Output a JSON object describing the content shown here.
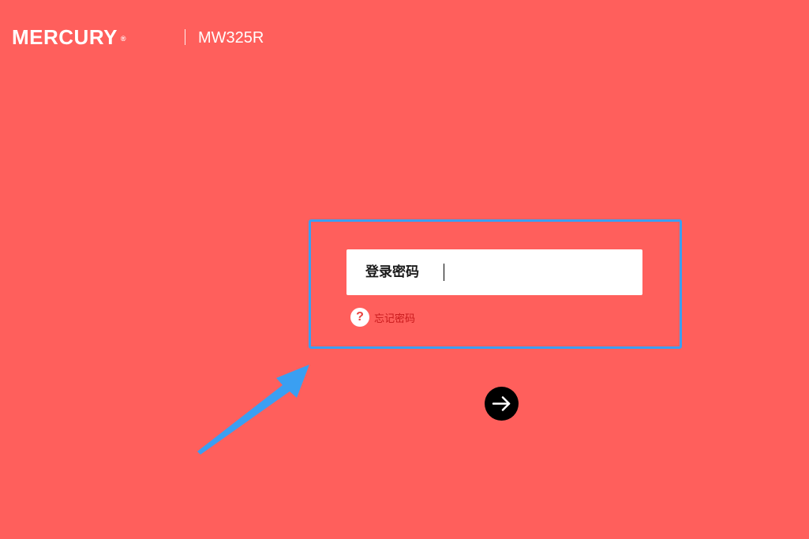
{
  "header": {
    "brand": "MERCURY",
    "brand_mark": "®",
    "model": "MW325R"
  },
  "login": {
    "password_label": "登录密码",
    "password_value": "",
    "forgot_icon": "question-icon",
    "forgot_label": "忘记密码",
    "submit_icon": "arrow-right-icon"
  },
  "colors": {
    "background": "#ff5f5c",
    "highlight": "#3a9ff2",
    "forgot_text": "#c8191b"
  }
}
